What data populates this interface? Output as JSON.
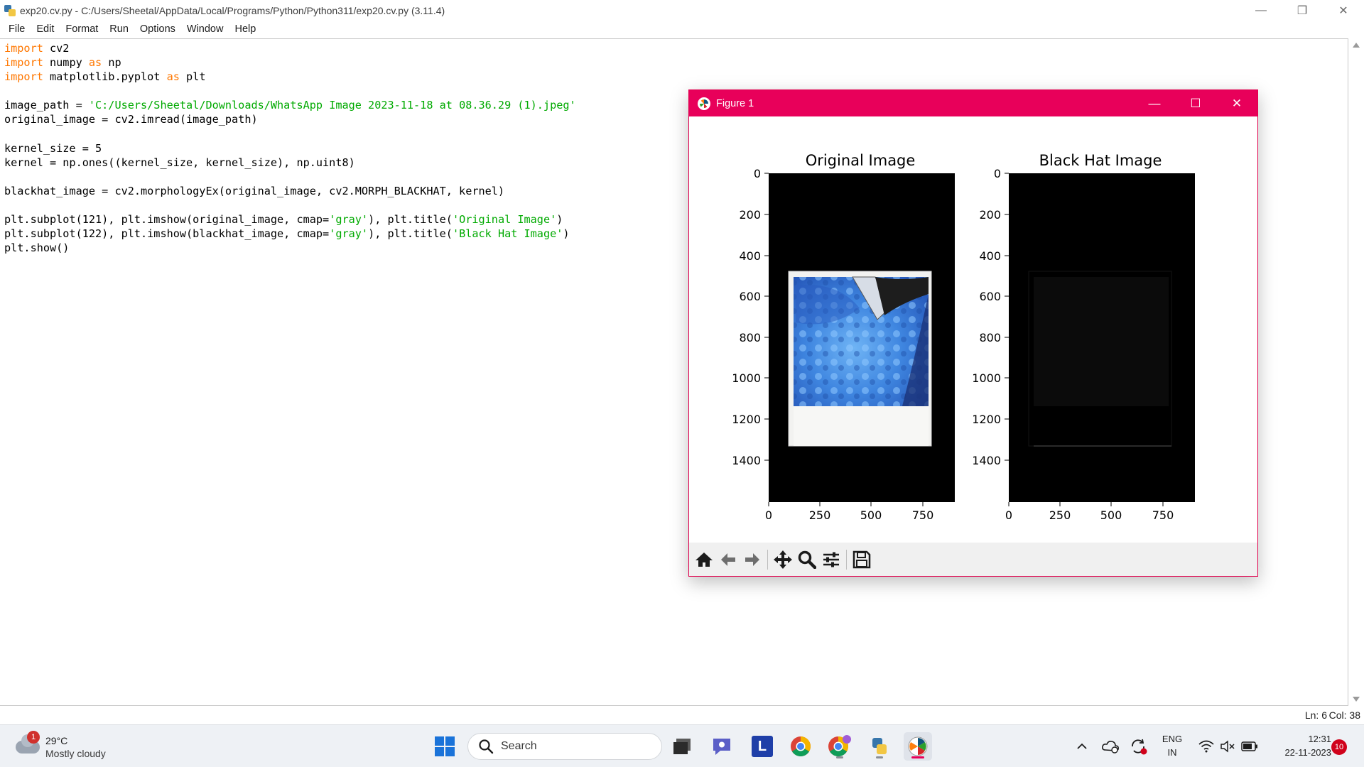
{
  "window": {
    "title": "exp20.cv.py - C:/Users/Sheetal/AppData/Local/Programs/Python/Python311/exp20.cv.py (3.11.4)"
  },
  "menu": [
    "File",
    "Edit",
    "Format",
    "Run",
    "Options",
    "Window",
    "Help"
  ],
  "code_lines": [
    [
      {
        "t": "import",
        "c": "kw"
      },
      {
        "t": " cv2"
      }
    ],
    [
      {
        "t": "import",
        "c": "kw"
      },
      {
        "t": " numpy "
      },
      {
        "t": "as",
        "c": "kw"
      },
      {
        "t": " np"
      }
    ],
    [
      {
        "t": "import",
        "c": "kw"
      },
      {
        "t": " matplotlib.pyplot "
      },
      {
        "t": "as",
        "c": "kw"
      },
      {
        "t": " plt"
      }
    ],
    [],
    [
      {
        "t": "image_path = "
      },
      {
        "t": "'C:/Users/Sheetal/Downloads/WhatsApp Image 2023-11-18 at 08.36.29 (1).jpeg'",
        "c": "str"
      }
    ],
    [
      {
        "t": "original_image = cv2.imread(image_path)"
      }
    ],
    [],
    [
      {
        "t": "kernel_size = 5"
      }
    ],
    [
      {
        "t": "kernel = np.ones((kernel_size, kernel_size), np.uint8)"
      }
    ],
    [],
    [
      {
        "t": "blackhat_image = cv2.morphologyEx(original_image, cv2.MORPH_BLACKHAT, kernel)"
      }
    ],
    [],
    [
      {
        "t": "plt.subplot(121), plt.imshow(original_image, cmap="
      },
      {
        "t": "'gray'",
        "c": "str"
      },
      {
        "t": "), plt.title("
      },
      {
        "t": "'Original Image'",
        "c": "str"
      },
      {
        "t": ")"
      }
    ],
    [
      {
        "t": "plt.subplot(122), plt.imshow(blackhat_image, cmap="
      },
      {
        "t": "'gray'",
        "c": "str"
      },
      {
        "t": "), plt.title("
      },
      {
        "t": "'Black Hat Image'",
        "c": "str"
      },
      {
        "t": ")"
      }
    ],
    [
      {
        "t": "plt.show()"
      }
    ]
  ],
  "status": {
    "ln": "Ln: 6",
    "col": "Col: 38"
  },
  "figure": {
    "title": "Figure 1",
    "subplots": [
      {
        "title": "Original Image",
        "yticks": [
          "0",
          "200",
          "400",
          "600",
          "800",
          "1000",
          "1200",
          "1400"
        ],
        "xticks": [
          "0",
          "250",
          "500",
          "750"
        ]
      },
      {
        "title": "Black Hat Image",
        "yticks": [
          "0",
          "200",
          "400",
          "600",
          "800",
          "1000",
          "1200",
          "1400"
        ],
        "xticks": [
          "0",
          "250",
          "500",
          "750"
        ]
      }
    ],
    "toolbar": [
      "home-icon",
      "back-icon",
      "forward-icon",
      "pan-icon",
      "zoom-icon",
      "configure-icon",
      "save-icon"
    ]
  },
  "taskbar": {
    "weather": {
      "badge": "1",
      "temp": "29°C",
      "desc": "Mostly cloudy"
    },
    "search_label": "Search",
    "lang": [
      "ENG",
      "IN"
    ],
    "time": "12:31",
    "date": "22-11-2023",
    "notifications": "10"
  },
  "colors": {
    "keyword": "#ff7700",
    "string": "#00aa00",
    "figure_title_bar": "#e8005a"
  }
}
